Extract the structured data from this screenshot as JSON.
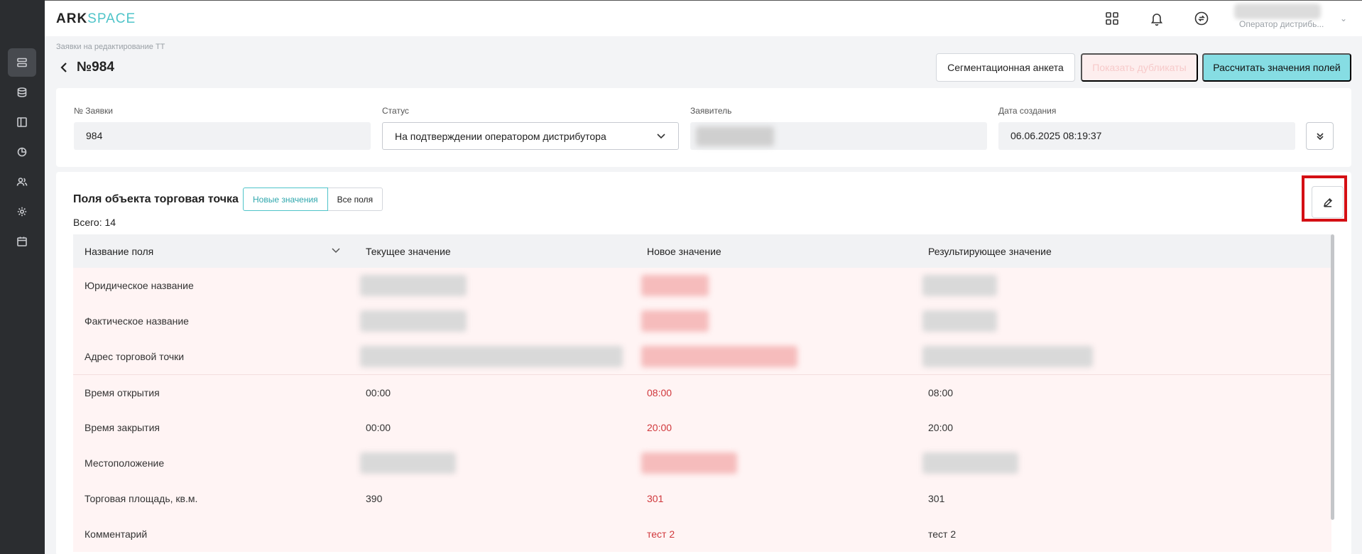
{
  "app": {
    "logo_primary": "ARK",
    "logo_secondary": "SPACE"
  },
  "rail": {
    "items": [
      {
        "icon": "requests-icon",
        "active": true
      },
      {
        "icon": "database-icon",
        "active": false
      },
      {
        "icon": "layout-icon",
        "active": false
      },
      {
        "icon": "pie-chart-icon",
        "active": false
      },
      {
        "icon": "users-icon",
        "active": false
      },
      {
        "icon": "settings-icon",
        "active": false
      },
      {
        "icon": "calendar-icon",
        "active": false
      }
    ]
  },
  "topbar": {
    "icons": [
      "apps-grid-icon",
      "bell-icon",
      "sync-icon"
    ],
    "user_role": "Оператор дистрибь..."
  },
  "header": {
    "breadcrumb": "Заявки на редактирование ТТ",
    "title": "№984",
    "buttons": {
      "segmentation": "Сегментационная анкета",
      "duplicates": "Показать дубликаты",
      "calculate": "Рассчитать значения полей"
    }
  },
  "info": {
    "request_number_label": "№ Заявки",
    "request_number": "984",
    "status_label": "Статус",
    "status_value": "На подтверждении оператором дистрибутора",
    "applicant_label": "Заявитель",
    "created_label": "Дата создания",
    "created_value": "06.06.2025 08:19:37"
  },
  "fields": {
    "title": "Поля объекта торговая точка",
    "toggle_new": "Новые значения",
    "toggle_all": "Все поля",
    "total": "Всего: 14",
    "columns": [
      "Название поля",
      "Текущее значение",
      "Новое значение",
      "Результирующее значение"
    ],
    "rows": [
      {
        "name": "Юридическое название",
        "current": "",
        "new": "",
        "result": ""
      },
      {
        "name": "Фактическое название",
        "current": "",
        "new": "",
        "result": ""
      },
      {
        "name": "Адрес торговой точки",
        "current": "",
        "new": "",
        "result": ""
      },
      {
        "name": "Время открытия",
        "current": "00:00",
        "new": "08:00",
        "result": "08:00"
      },
      {
        "name": "Время закрытия",
        "current": "00:00",
        "new": "20:00",
        "result": "20:00"
      },
      {
        "name": "Местоположение",
        "current": "",
        "new": "",
        "result": ""
      },
      {
        "name": "Торговая площадь, кв.м.",
        "current": "390",
        "new": "301",
        "result": "301"
      },
      {
        "name": "Комментарий",
        "current": "",
        "new": "тест 2",
        "result": "тест 2"
      }
    ]
  },
  "colors": {
    "accent": "#4fc4c9",
    "primary_button": "#86dde3",
    "new_value": "#d0383c",
    "row_highlight": "#fff4f4",
    "annotation": "#d40f14"
  }
}
